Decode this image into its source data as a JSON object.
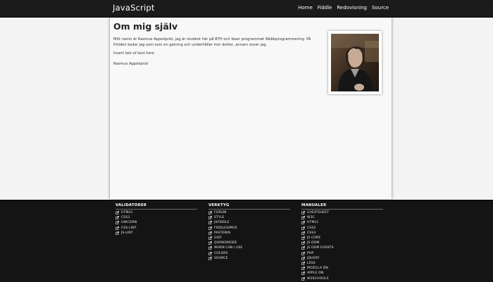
{
  "header": {
    "brand": "JavaScript",
    "nav": [
      "Home",
      "Fiddle",
      "Redovisning",
      "Source"
    ]
  },
  "main": {
    "title": "Om mig själv",
    "intro": "Mitt namn är Rasmus Appelqvist, jag är student här på BTH och läser programmet Webbprogrammering. På fritiden kodar jag som som en galning och underhåller min dotter, annars sover jag.",
    "placeholder": "Insert lots of text here",
    "signature": "Rasmus Appelqvist"
  },
  "footer": {
    "columns": [
      {
        "heading": "VALIDATORER",
        "links": [
          "HTML5",
          "CSS3",
          "UNICORN",
          "CSS-LINT",
          "JS-LINT"
        ]
      },
      {
        "heading": "VERKTYG",
        "links": [
          "FORUM",
          "STYLE",
          "JSFIDDLE",
          "FIDDLES/MOS",
          "PASTEBIN",
          "GIST",
          "QUIRKSMODE",
          "WHEN CAN I USE",
          "COLORS",
          "SOURCE"
        ]
      },
      {
        "heading": "MANUALER",
        "links": [
          "CHEATSHEET",
          "W3C",
          "HTML5",
          "CSS2",
          "CSS3",
          "JS CORE",
          "JS DOM",
          "JS DOM EVENTS",
          "PHP",
          "JQUERY",
          "LESS",
          "MOZILLA DN",
          "APPLE DN",
          "W3SCHOOLS"
        ]
      }
    ]
  },
  "icons": {
    "footer_link": "external-link-icon"
  },
  "colors": {
    "topbar": "#1b1b1b",
    "footer": "#141414",
    "content_bg": "#f8f8f8",
    "side_bg": "#f3f3f3"
  }
}
